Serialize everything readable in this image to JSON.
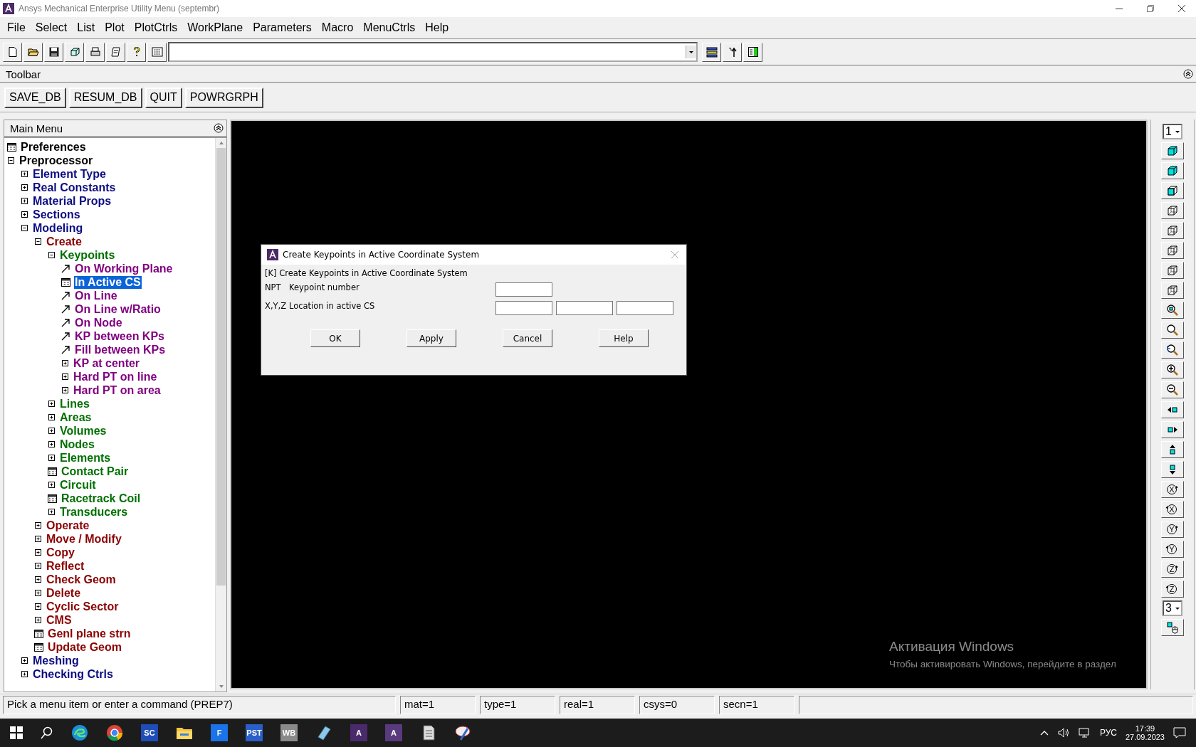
{
  "window": {
    "title": "Ansys Mechanical Enterprise Utility Menu (septembr)"
  },
  "menu_bar": [
    "File",
    "Select",
    "List",
    "Plot",
    "PlotCtrls",
    "WorkPlane",
    "Parameters",
    "Macro",
    "MenuCtrls",
    "Help"
  ],
  "toolbar": {
    "title": "Toolbar",
    "buttons": [
      "SAVE_DB",
      "RESUM_DB",
      "QUIT",
      "POWRGRPH"
    ]
  },
  "main_menu": {
    "title": "Main Menu",
    "items": [
      {
        "label": "Preferences",
        "kind": "dialog",
        "selected": false
      },
      {
        "label": "Preprocessor",
        "kind": "folder",
        "expanded": true,
        "selected": false,
        "children": [
          {
            "label": "Element Type",
            "kind": "folder",
            "expanded": false,
            "selected": false
          },
          {
            "label": "Real Constants",
            "kind": "folder",
            "expanded": false,
            "selected": false
          },
          {
            "label": "Material Props",
            "kind": "folder",
            "expanded": false,
            "selected": false
          },
          {
            "label": "Sections",
            "kind": "folder",
            "expanded": false,
            "selected": false
          },
          {
            "label": "Modeling",
            "kind": "folder",
            "expanded": true,
            "selected": false,
            "children": [
              {
                "label": "Create",
                "kind": "folder",
                "expanded": true,
                "selected": false,
                "children": [
                  {
                    "label": "Keypoints",
                    "kind": "folder",
                    "expanded": true,
                    "selected": false,
                    "children": [
                      {
                        "label": "On Working Plane",
                        "kind": "pick",
                        "selected": false
                      },
                      {
                        "label": "In Active CS",
                        "kind": "dialog",
                        "selected": true
                      },
                      {
                        "label": "On Line",
                        "kind": "pick",
                        "selected": false
                      },
                      {
                        "label": "On Line w/Ratio",
                        "kind": "pick",
                        "selected": false
                      },
                      {
                        "label": "On Node",
                        "kind": "pick",
                        "selected": false
                      },
                      {
                        "label": "KP between KPs",
                        "kind": "pick",
                        "selected": false
                      },
                      {
                        "label": "Fill between KPs",
                        "kind": "pick",
                        "selected": false
                      },
                      {
                        "label": "KP at center",
                        "kind": "folder",
                        "expanded": false,
                        "selected": false
                      },
                      {
                        "label": "Hard PT on line",
                        "kind": "folder",
                        "expanded": false,
                        "selected": false
                      },
                      {
                        "label": "Hard PT on area",
                        "kind": "folder",
                        "expanded": false,
                        "selected": false
                      }
                    ]
                  },
                  {
                    "label": "Lines",
                    "kind": "folder",
                    "expanded": false,
                    "selected": false
                  },
                  {
                    "label": "Areas",
                    "kind": "folder",
                    "expanded": false,
                    "selected": false
                  },
                  {
                    "label": "Volumes",
                    "kind": "folder",
                    "expanded": false,
                    "selected": false
                  },
                  {
                    "label": "Nodes",
                    "kind": "folder",
                    "expanded": false,
                    "selected": false
                  },
                  {
                    "label": "Elements",
                    "kind": "folder",
                    "expanded": false,
                    "selected": false
                  },
                  {
                    "label": "Contact Pair",
                    "kind": "dialog",
                    "selected": false
                  },
                  {
                    "label": "Circuit",
                    "kind": "folder",
                    "expanded": false,
                    "selected": false
                  },
                  {
                    "label": "Racetrack Coil",
                    "kind": "dialog",
                    "selected": false
                  },
                  {
                    "label": "Transducers",
                    "kind": "folder",
                    "expanded": false,
                    "selected": false
                  }
                ]
              },
              {
                "label": "Operate",
                "kind": "folder",
                "expanded": false,
                "selected": false
              },
              {
                "label": "Move / Modify",
                "kind": "folder",
                "expanded": false,
                "selected": false
              },
              {
                "label": "Copy",
                "kind": "folder",
                "expanded": false,
                "selected": false
              },
              {
                "label": "Reflect",
                "kind": "folder",
                "expanded": false,
                "selected": false
              },
              {
                "label": "Check Geom",
                "kind": "folder",
                "expanded": false,
                "selected": false
              },
              {
                "label": "Delete",
                "kind": "folder",
                "expanded": false,
                "selected": false
              },
              {
                "label": "Cyclic Sector",
                "kind": "folder",
                "expanded": false,
                "selected": false
              },
              {
                "label": "CMS",
                "kind": "folder",
                "expanded": false,
                "selected": false
              },
              {
                "label": "Genl plane strn",
                "kind": "dialog",
                "selected": false
              },
              {
                "label": "Update Geom",
                "kind": "dialog",
                "selected": false
              }
            ]
          },
          {
            "label": "Meshing",
            "kind": "folder",
            "expanded": false,
            "selected": false
          },
          {
            "label": "Checking Ctrls",
            "kind": "folder",
            "expanded": false,
            "selected": false
          }
        ]
      }
    ]
  },
  "dialog": {
    "title": "Create Keypoints in Active Coordinate System",
    "heading": "[K]  Create Keypoints in Active Coordinate System",
    "fields": [
      {
        "code": "NPT",
        "label": "Keypoint number",
        "kind": "scalar"
      },
      {
        "code": "X,Y,Z",
        "label": "Location in active CS",
        "kind": "vector"
      }
    ],
    "buttons": [
      "OK",
      "Apply",
      "Cancel",
      "Help"
    ]
  },
  "watermark": {
    "title": "Активация Windows",
    "text": "Чтобы активировать Windows, перейдите в раздел"
  },
  "view_toolbar": [
    {
      "kind": "dropdown",
      "value": "1"
    },
    {
      "kind": "iso-view"
    },
    {
      "kind": "oblique-view"
    },
    {
      "kind": "front-view"
    },
    {
      "kind": "top-view"
    },
    {
      "kind": "back-view"
    },
    {
      "kind": "left-view"
    },
    {
      "kind": "right-view"
    },
    {
      "kind": "bottom-view"
    },
    {
      "kind": "zoom-fit"
    },
    {
      "kind": "zoom"
    },
    {
      "kind": "zoom-back"
    },
    {
      "kind": "zoom-in"
    },
    {
      "kind": "zoom-out"
    },
    {
      "kind": "pan-left"
    },
    {
      "kind": "pan-right"
    },
    {
      "kind": "pan-up"
    },
    {
      "kind": "pan-down"
    },
    {
      "kind": "rotate-cw",
      "label": "X"
    },
    {
      "kind": "rotate-ccw",
      "label": "X"
    },
    {
      "kind": "rotate-cw",
      "label": "Y"
    },
    {
      "kind": "rotate-ccw",
      "label": "Y"
    },
    {
      "kind": "rotate-cw",
      "label": "Z"
    },
    {
      "kind": "rotate-ccw",
      "label": "Z"
    },
    {
      "kind": "dropdown",
      "value": "3"
    },
    {
      "kind": "dynamic"
    }
  ],
  "status_bar": [
    "Pick a menu item or enter a command (PREP7)",
    "mat=1",
    "type=1",
    "real=1",
    "csys=0",
    "secn=1"
  ],
  "taskbar": {
    "apps": [
      {
        "kind": "edge"
      },
      {
        "kind": "chrome"
      },
      {
        "kind": "tile",
        "label": "SC",
        "color": "#1e4db7"
      },
      {
        "kind": "explorer"
      },
      {
        "kind": "tile",
        "label": "F",
        "color": "#1a73e8"
      },
      {
        "kind": "tile",
        "label": "PST",
        "color": "#2b5fc7"
      },
      {
        "kind": "tile",
        "label": "WB",
        "color": "#8a8a8a"
      },
      {
        "kind": "notebook"
      },
      {
        "kind": "tile",
        "label": "A",
        "color": "#4a2a6a"
      },
      {
        "kind": "tile",
        "label": "A",
        "color": "#5a3a7e"
      },
      {
        "kind": "document"
      },
      {
        "kind": "tool"
      }
    ],
    "language": "РУС",
    "time": "17:39",
    "date": "27.09.2023"
  }
}
